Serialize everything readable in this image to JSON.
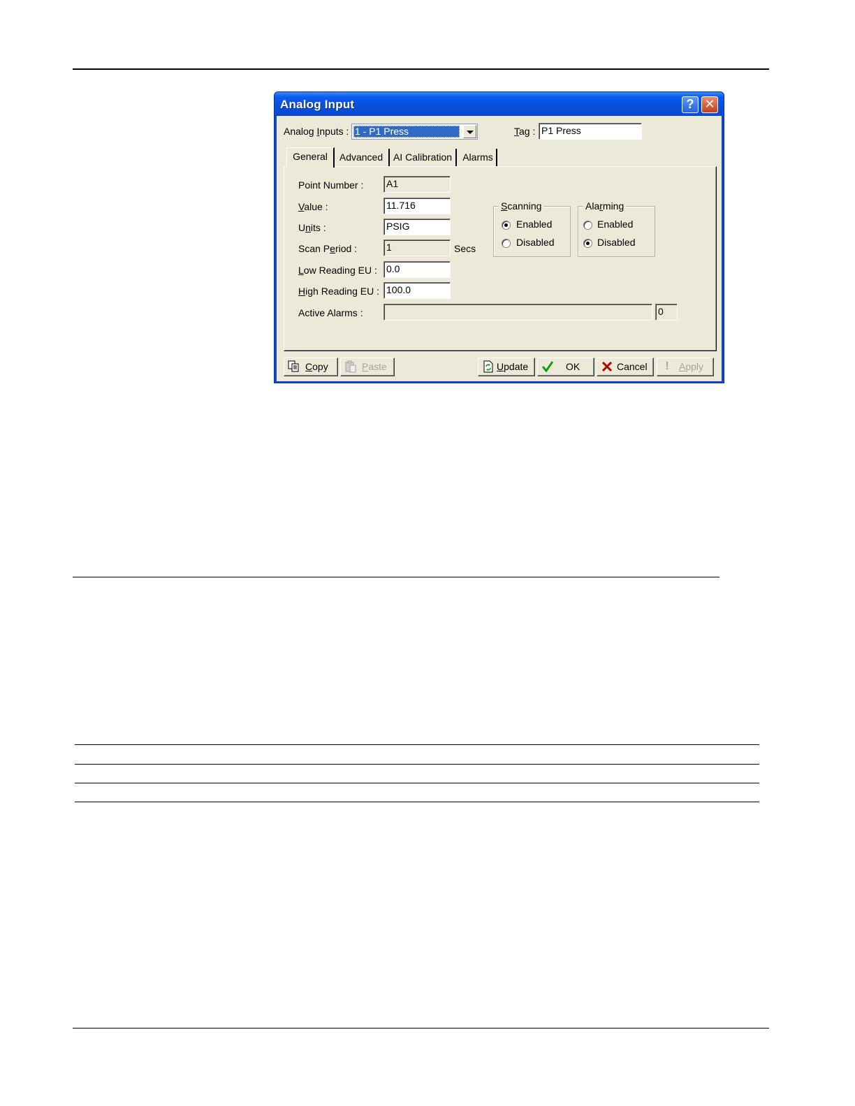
{
  "dialog": {
    "title": "Analog Input",
    "help_glyph": "?",
    "close_glyph": "✕",
    "analog_inputs_label_pre": "Analog ",
    "analog_inputs_label_u": "I",
    "analog_inputs_label_post": "nputs :",
    "analog_inputs_value": "1 - P1 Press",
    "tag_label_u": "T",
    "tag_label_post": "ag :",
    "tag_value": "P1 Press",
    "tabs": [
      "General",
      "Advanced",
      "AI Calibration",
      "Alarms"
    ],
    "fields": {
      "point_number_label": "Point Number :",
      "point_number_value": "A1",
      "value_label_u": "V",
      "value_label_post": "alue :",
      "value_value": "11.716",
      "units_label_pre": "U",
      "units_label_u": "n",
      "units_label_post": "its :",
      "units_value": "PSIG",
      "scan_period_label_pre": "Scan P",
      "scan_period_label_u": "e",
      "scan_period_label_post": "riod :",
      "scan_period_value": "1",
      "scan_period_units": "Secs",
      "low_reading_label_u": "L",
      "low_reading_label_post": "ow Reading EU :",
      "low_reading_value": "0.0",
      "high_reading_label_u": "H",
      "high_reading_label_post": "igh Reading EU :",
      "high_reading_value": "100.0",
      "active_alarms_label": "Active Alarms :",
      "active_alarms_value": "",
      "active_alarms_count": "0"
    },
    "scanning": {
      "title_u": "S",
      "title_post": "canning",
      "enabled_label": "Enabled",
      "disabled_label": "Disabled",
      "selected": "Enabled"
    },
    "alarming": {
      "title_pre": "Ala",
      "title_u": "r",
      "title_post": "ming",
      "enabled_label": "Enabled",
      "disabled_label": "Disabled",
      "selected": "Disabled"
    },
    "buttons": {
      "copy_u": "C",
      "copy_post": "opy",
      "paste_u": "P",
      "paste_post": "aste",
      "update_u": "U",
      "update_post": "pdate",
      "ok": "OK",
      "cancel": "Cancel",
      "apply_u": "A",
      "apply_post": "pply"
    },
    "icons": {
      "copy": "copy-icon",
      "paste": "paste-icon",
      "update": "update-icon",
      "ok": "checkmark-icon",
      "cancel": "x-icon",
      "apply": "exclamation-icon"
    },
    "colors": {
      "titlebar": "#0a5cf0",
      "selection": "#316ac5",
      "dialog_face": "#ece9d8",
      "ok_check": "#1a9a1a",
      "cancel_x": "#b00000"
    }
  }
}
